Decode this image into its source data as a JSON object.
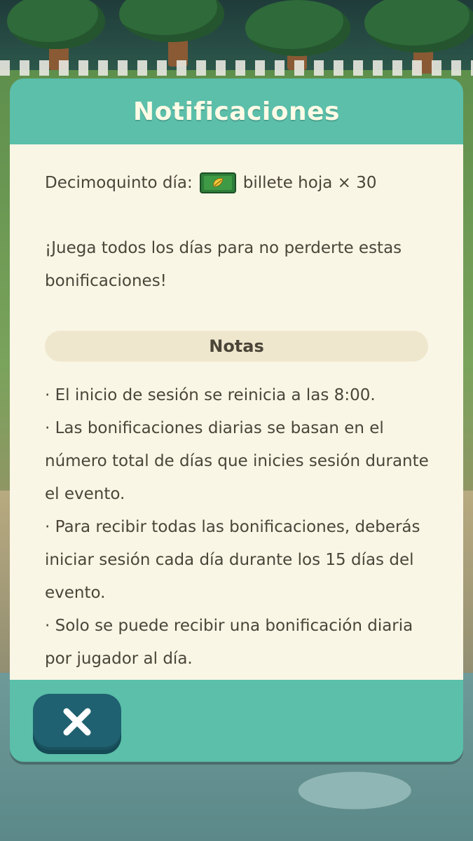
{
  "dialog": {
    "title": "Notificaciones",
    "reward": {
      "day_label": "Decimoquinto día:",
      "item_icon": "leaf-ticket-icon",
      "item_text": "billete hoja × 30"
    },
    "promo_text": "¡Juega todos los días para no perderte estas bonificaciones!",
    "notes_heading": "Notas",
    "notes": [
      "· El inicio de sesión se reinicia a las 8:00.",
      "· Las bonificaciones diarias se basan en el número total de días que inicies sesión durante el evento.",
      "· Para recibir todas las bonificaciones, deberás iniciar sesión cada día durante los 15 días del evento.",
      "· Solo se puede recibir una bonificación diaria por jugador al día."
    ],
    "close_icon": "close-icon"
  },
  "colors": {
    "header_teal": "#5bbfaa",
    "panel_cream": "#faf6e6",
    "notes_bar": "#efe7cd",
    "text": "#4a4538",
    "close_button": "#1f6170"
  }
}
